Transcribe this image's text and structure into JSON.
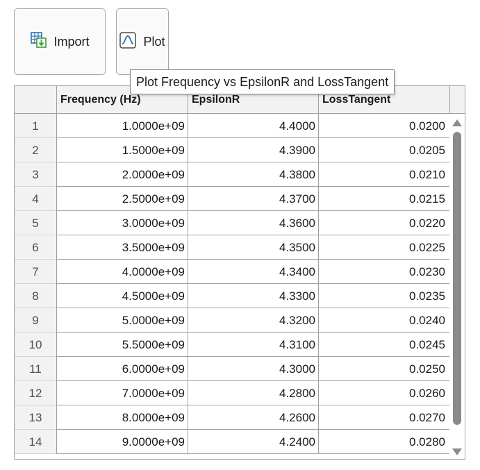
{
  "toolbar": {
    "import_label": "Import",
    "import_icon": "import-icon",
    "plot_label": "Plot",
    "plot_icon": "plot-icon",
    "plot_tooltip": "Plot Frequency vs EpsilonR and LossTangent"
  },
  "table": {
    "columns": [
      "Frequency (Hz)",
      "EpsilonR",
      "LossTangent"
    ],
    "rows": [
      {
        "n": "1",
        "freq": "1.0000e+09",
        "eps": "4.4000",
        "loss": "0.0200"
      },
      {
        "n": "2",
        "freq": "1.5000e+09",
        "eps": "4.3900",
        "loss": "0.0205"
      },
      {
        "n": "3",
        "freq": "2.0000e+09",
        "eps": "4.3800",
        "loss": "0.0210"
      },
      {
        "n": "4",
        "freq": "2.5000e+09",
        "eps": "4.3700",
        "loss": "0.0215"
      },
      {
        "n": "5",
        "freq": "3.0000e+09",
        "eps": "4.3600",
        "loss": "0.0220"
      },
      {
        "n": "6",
        "freq": "3.5000e+09",
        "eps": "4.3500",
        "loss": "0.0225"
      },
      {
        "n": "7",
        "freq": "4.0000e+09",
        "eps": "4.3400",
        "loss": "0.0230"
      },
      {
        "n": "8",
        "freq": "4.5000e+09",
        "eps": "4.3300",
        "loss": "0.0235"
      },
      {
        "n": "9",
        "freq": "5.0000e+09",
        "eps": "4.3200",
        "loss": "0.0240"
      },
      {
        "n": "10",
        "freq": "5.5000e+09",
        "eps": "4.3100",
        "loss": "0.0245"
      },
      {
        "n": "11",
        "freq": "6.0000e+09",
        "eps": "4.3000",
        "loss": "0.0250"
      },
      {
        "n": "12",
        "freq": "7.0000e+09",
        "eps": "4.2800",
        "loss": "0.0260"
      },
      {
        "n": "13",
        "freq": "8.0000e+09",
        "eps": "4.2600",
        "loss": "0.0270"
      },
      {
        "n": "14",
        "freq": "9.0000e+09",
        "eps": "4.2400",
        "loss": "0.0280"
      }
    ]
  },
  "colors": {
    "header_bg": "#f2f2f2",
    "grid": "#a0a0a0",
    "scrollbar": "#8a8a8a",
    "icon_green": "#3a9a3a",
    "icon_blue": "#2a6fb0"
  }
}
